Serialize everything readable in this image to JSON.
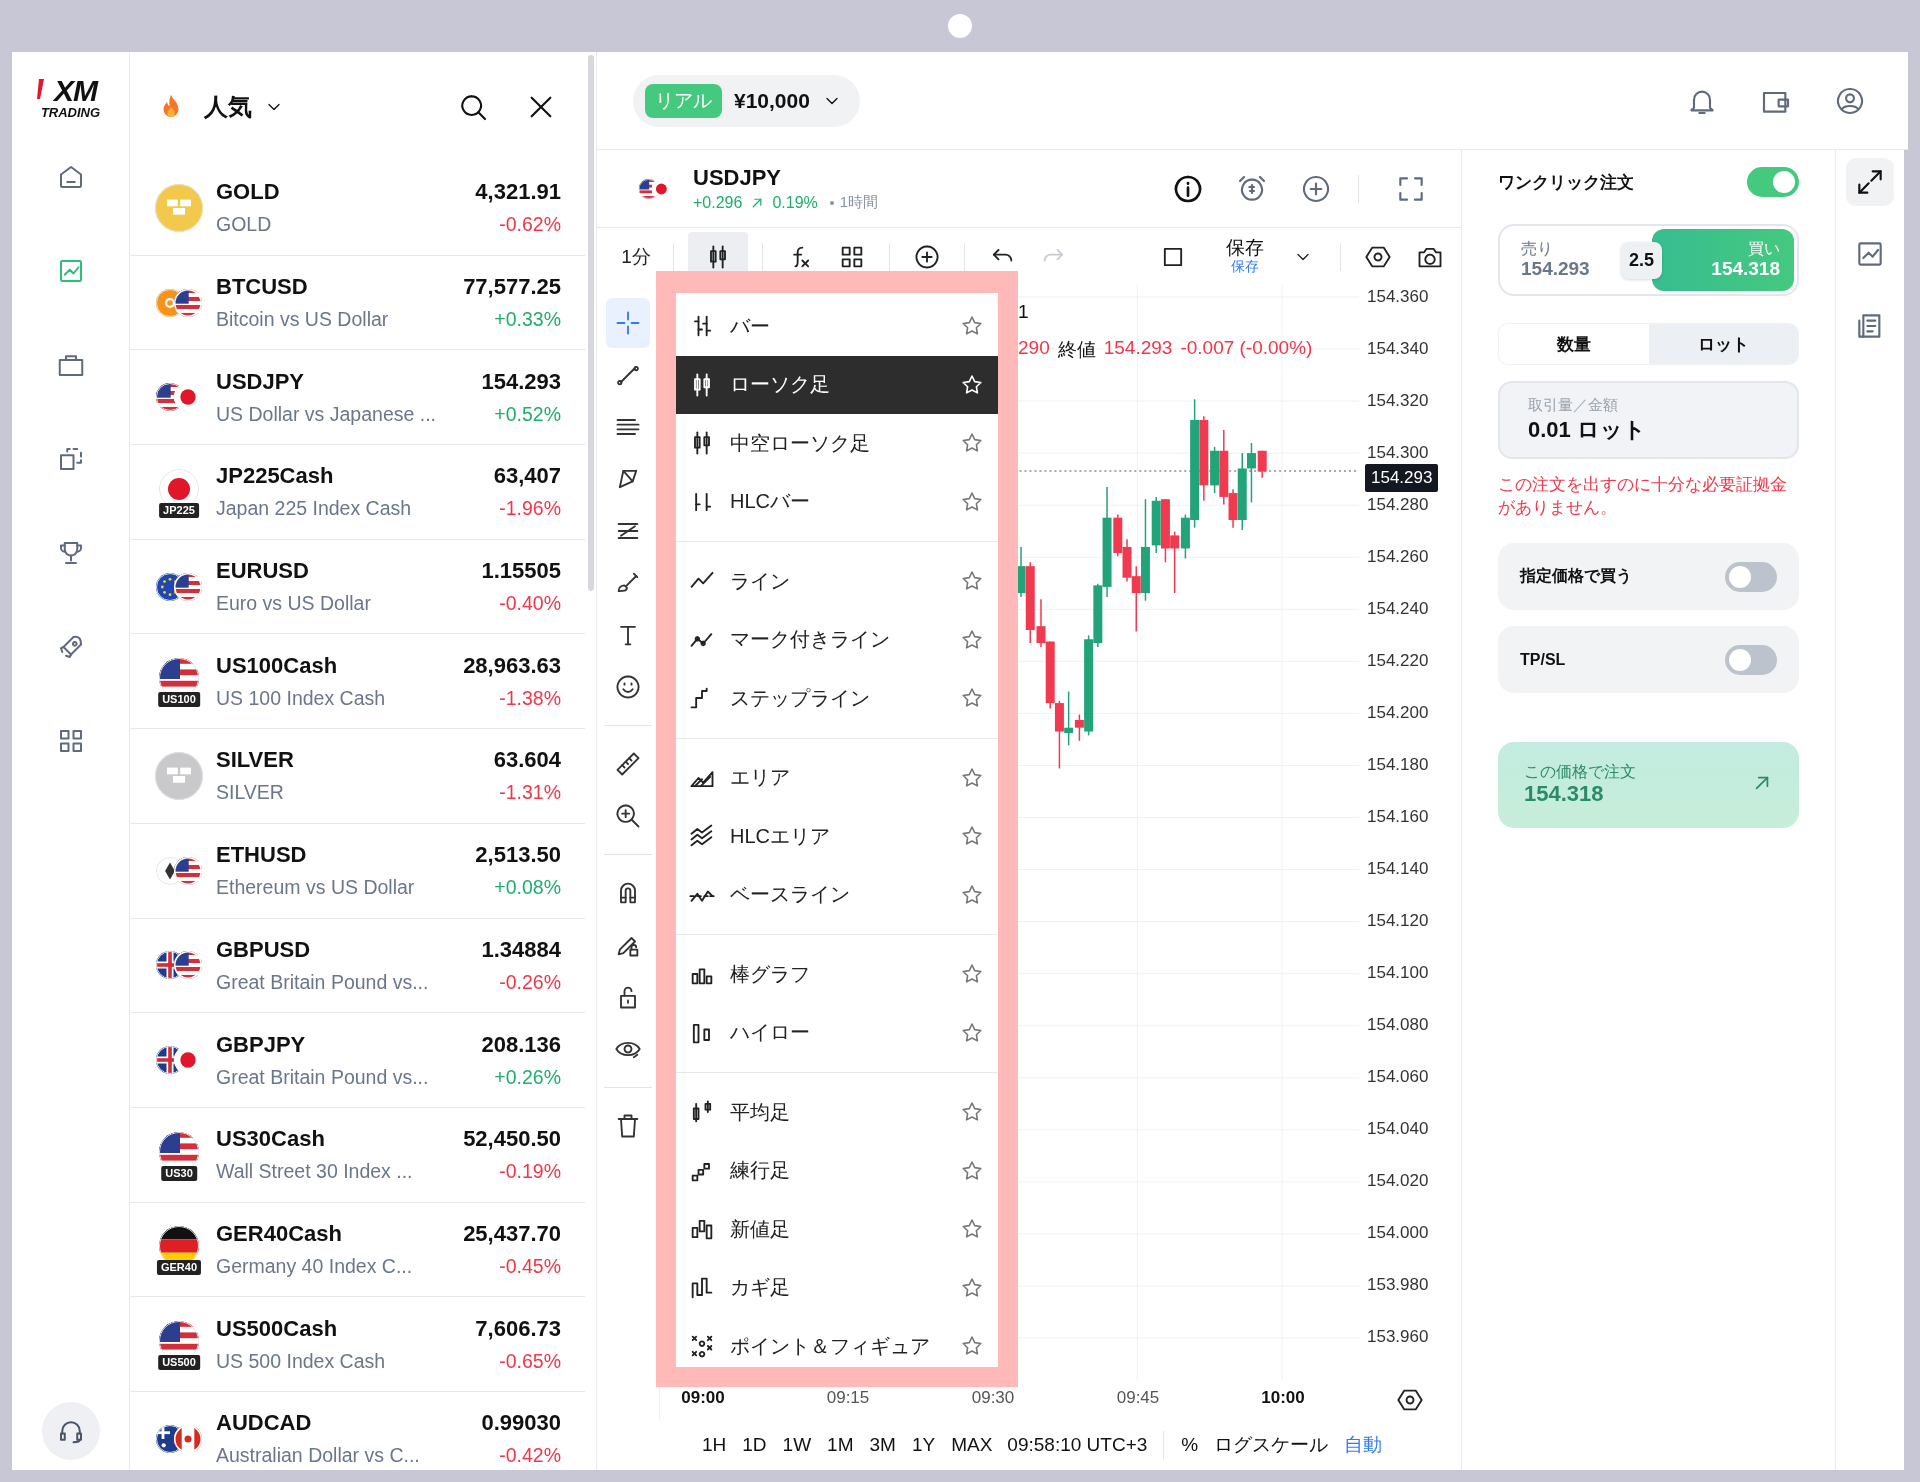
{
  "logo": {
    "mark": "XM",
    "tagline": "TRADING"
  },
  "nav_items": [
    {
      "selected": false
    },
    {
      "selected": true
    },
    {
      "selected": false
    },
    {
      "selected": false
    },
    {
      "selected": false
    },
    {
      "selected": false
    },
    {
      "selected": false
    }
  ],
  "watchlist": {
    "title": "人気",
    "rows": [
      {
        "kind": "metal",
        "symbol": "GOLD",
        "name": "GOLD",
        "price": "4,321.91",
        "change": "-0.62%",
        "color": "#f0374a"
      },
      {
        "kind": "pair",
        "symbol": "BTCUSD",
        "name": "Bitcoin vs US Dollar",
        "price": "77,577.25",
        "change": "+0.33%",
        "color": "#1fae6b"
      },
      {
        "kind": "pair",
        "symbol": "USDJPY",
        "name": "US Dollar vs Japanese ...",
        "price": "154.293",
        "change": "+0.52%",
        "color": "#1fae6b"
      },
      {
        "kind": "index",
        "badge": "JP225",
        "symbol": "JP225Cash",
        "name": "Japan 225 Index Cash",
        "price": "63,407",
        "change": "-1.96%",
        "color": "#f0374a"
      },
      {
        "kind": "pair",
        "symbol": "EURUSD",
        "name": "Euro vs US Dollar",
        "price": "1.15505",
        "change": "-0.40%",
        "color": "#f0374a"
      },
      {
        "kind": "index",
        "badge": "US100",
        "symbol": "US100Cash",
        "name": "US 100 Index Cash",
        "price": "28,963.63",
        "change": "-1.38%",
        "color": "#f0374a"
      },
      {
        "kind": "metal",
        "symbol": "SILVER",
        "name": "SILVER",
        "price": "63.604",
        "change": "-1.31%",
        "color": "#f0374a"
      },
      {
        "kind": "pair",
        "symbol": "ETHUSD",
        "name": "Ethereum vs US Dollar",
        "price": "2,513.50",
        "change": "+0.08%",
        "color": "#1fae6b"
      },
      {
        "kind": "pair",
        "symbol": "GBPUSD",
        "name": "Great Britain Pound vs...",
        "price": "1.34884",
        "change": "-0.26%",
        "color": "#f0374a"
      },
      {
        "kind": "pair",
        "symbol": "GBPJPY",
        "name": "Great Britain Pound vs...",
        "price": "208.136",
        "change": "+0.26%",
        "color": "#1fae6b"
      },
      {
        "kind": "index",
        "badge": "US30",
        "symbol": "US30Cash",
        "name": "Wall Street 30 Index ...",
        "price": "52,450.50",
        "change": "-0.19%",
        "color": "#f0374a"
      },
      {
        "kind": "index",
        "badge": "GER40",
        "symbol": "GER40Cash",
        "name": "Germany 40 Index C...",
        "price": "25,437.70",
        "change": "-0.45%",
        "color": "#f0374a"
      },
      {
        "kind": "index",
        "badge": "US500",
        "symbol": "US500Cash",
        "name": "US 500 Index Cash",
        "price": "7,606.73",
        "change": "-0.65%",
        "color": "#f0374a"
      },
      {
        "kind": "pair",
        "symbol": "AUDCAD",
        "name": "Australian Dollar vs C...",
        "price": "0.99030",
        "change": "-0.42%",
        "color": "#f0374a"
      }
    ]
  },
  "account": {
    "type": "リアル",
    "balance": "¥10,000"
  },
  "symbol_header": {
    "symbol": "USDJPY",
    "change": "+0.296",
    "change_pct": "0.19%",
    "interval": "1時間"
  },
  "toolbar": {
    "interval": "1分",
    "chart_type_open": true,
    "redo_disabled": true,
    "save_label": "保存",
    "save_status": "保存"
  },
  "drawing_tools": [
    {
      "tools": [
        {
          "selected": true
        },
        {
          "selected": false
        },
        {
          "selected": false
        },
        {
          "selected": false
        },
        {
          "selected": false
        },
        {
          "selected": false
        },
        {
          "selected": false
        },
        {
          "selected": false
        }
      ]
    },
    {
      "tools": [
        {
          "selected": false
        },
        {
          "selected": false
        }
      ]
    },
    {
      "tools": [
        {
          "selected": false
        },
        {
          "selected": false
        },
        {
          "selected": false
        },
        {
          "selected": false
        }
      ]
    },
    {
      "tools": [
        {
          "selected": false
        }
      ]
    }
  ],
  "chart_type_menu": {
    "groups": [
      {
        "items": [
          {
            "label": "バー",
            "selected": false,
            "favorite": false
          },
          {
            "label": "ローソク足",
            "selected": true,
            "favorite": false
          },
          {
            "label": "中空ローソク足",
            "selected": false,
            "favorite": false
          },
          {
            "label": "HLCバー",
            "selected": false,
            "favorite": false
          }
        ]
      },
      {
        "items": [
          {
            "label": "ライン",
            "selected": false,
            "favorite": false
          },
          {
            "label": "マーク付きライン",
            "selected": false,
            "favorite": false
          },
          {
            "label": "ステップライン",
            "selected": false,
            "favorite": false
          }
        ]
      },
      {
        "items": [
          {
            "label": "エリア",
            "selected": false,
            "favorite": false
          },
          {
            "label": "HLCエリア",
            "selected": false,
            "favorite": false
          },
          {
            "label": "ベースライン",
            "selected": false,
            "favorite": false
          }
        ]
      },
      {
        "items": [
          {
            "label": "棒グラフ",
            "selected": false,
            "favorite": false
          },
          {
            "label": "ハイロー",
            "selected": false,
            "favorite": false
          }
        ]
      },
      {
        "items": [
          {
            "label": "平均足",
            "selected": false,
            "favorite": false
          },
          {
            "label": "練行足",
            "selected": false,
            "favorite": false
          },
          {
            "label": "新値足",
            "selected": false,
            "favorite": false
          },
          {
            "label": "カギ足",
            "selected": false,
            "favorite": false
          },
          {
            "label": "ポイント＆フィギュア",
            "selected": false,
            "favorite": false
          }
        ]
      }
    ]
  },
  "legend": {
    "title": "1",
    "value": "290",
    "close_label": "終値",
    "close": "154.293",
    "change": "-0.007 (-0.00%)"
  },
  "price_axis": [
    "154.360",
    "154.340",
    "154.320",
    "154.300",
    "154.280",
    "154.260",
    "154.240",
    "154.220",
    "154.200",
    "154.180",
    "154.160",
    "154.140",
    "154.120",
    "154.100",
    "154.080",
    "154.060",
    "154.040",
    "154.020",
    "154.000",
    "153.980",
    "153.960"
  ],
  "last_price": "154.293",
  "time_axis": [
    {
      "label": "09:00",
      "major": true
    },
    {
      "label": "09:15",
      "major": false
    },
    {
      "label": "09:30",
      "major": false
    },
    {
      "label": "09:45",
      "major": false
    },
    {
      "label": "10:00",
      "major": true
    }
  ],
  "ranges": [
    "1H",
    "1D",
    "1W",
    "1M",
    "3M",
    "1Y",
    "MAX"
  ],
  "clock": "09:58:10 UTC+3",
  "scale_options": [
    {
      "label": "%",
      "active": false
    },
    {
      "label": "ログスケール",
      "active": false
    },
    {
      "label": "自動",
      "active": true
    }
  ],
  "order": {
    "title": "ワンクリック注文",
    "one_click": true,
    "sell": {
      "label": "売り",
      "price": "154.293"
    },
    "spread": "2.5",
    "buy": {
      "label": "買い",
      "price": "154.318"
    },
    "units": [
      {
        "label": "数量",
        "selected": false
      },
      {
        "label": "ロット",
        "selected": true
      }
    ],
    "amount": {
      "label": "取引量／金額",
      "value": "0.01 ロット"
    },
    "error": "この注文を出すのに十分な必要証拠金がありません。",
    "options": [
      {
        "label": "指定価格で買う",
        "on": false
      },
      {
        "label": "TP/SL",
        "on": false
      }
    ],
    "submit": {
      "label": "この価格で注文",
      "price": "154.318",
      "disabled": true
    }
  },
  "side_rail": [
    {
      "selected": true
    },
    {
      "selected": false
    },
    {
      "selected": false
    }
  ]
}
